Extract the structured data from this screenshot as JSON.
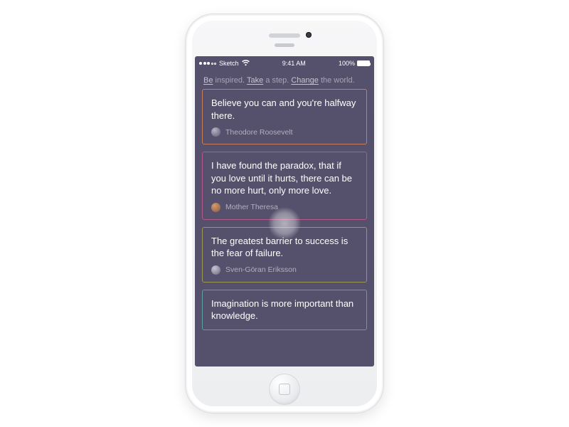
{
  "status_bar": {
    "carrier": "Sketch",
    "time": "9:41 AM",
    "battery": "100%"
  },
  "tagline": {
    "word1": "Be",
    "text1": " inspired. ",
    "word2": "Take",
    "text2": " a step. ",
    "word3": "Change",
    "text3": " the world."
  },
  "cards": [
    {
      "quote": "Believe you can and you're halfway there.",
      "author": "Theodore Roosevelt",
      "border_color": "orange"
    },
    {
      "quote": "I have found the paradox, that if you love until it hurts, there can be no more hurt, only more love.",
      "author": "Mother Theresa",
      "border_color": "magenta"
    },
    {
      "quote": "The greatest barrier to success is the fear of failure.",
      "author": "Sven-Göran Eriksson",
      "border_color": "olive"
    },
    {
      "quote": "Imagination is more important than knowledge.",
      "author": "",
      "border_color": "teal"
    }
  ]
}
